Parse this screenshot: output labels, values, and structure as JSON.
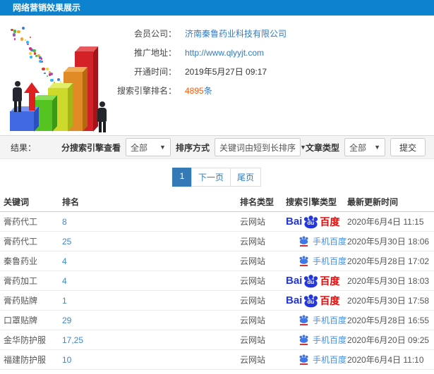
{
  "header": {
    "title": "网络营销效果展示"
  },
  "colors": {
    "header_bg": "#0d83cf",
    "link_blue": "#2f7bc3",
    "rank_link_blue": "#3a87d2",
    "highlight_red": "#ff5602",
    "pagination_active": "#337ab7",
    "baidu_blue": "#2336e0",
    "baidu_red": "#e10b0b",
    "mobile_baidu_blue": "#4a90e2"
  },
  "info": {
    "fields": [
      {
        "label": "会员公司：",
        "value": "济南秦鲁药业科技有限公司"
      },
      {
        "label": "推广地址：",
        "value": "http://www.qlyyjt.com"
      },
      {
        "label": "开通时间：",
        "value": "2019年5月27日 09:17"
      },
      {
        "label": "搜索引擎排名：",
        "value": "4895",
        "suffix": "条"
      }
    ]
  },
  "filters": {
    "result_label": "结果：",
    "engine_label": "分搜索引擎查看",
    "engine_value": "全部",
    "sort_label": "排序方式",
    "sort_value": "关键词由短到长排序",
    "article_label": "文章类型",
    "article_value": "全部",
    "submit_label": "提交",
    "caret": "▼"
  },
  "pagination": {
    "current": "1",
    "next": "下一页",
    "last": "尾页"
  },
  "table": {
    "columns": [
      "关键词",
      "排名",
      "排名类型",
      "搜索引擎类型",
      "最新更新时间"
    ],
    "engines": {
      "baidu_pc": {
        "bai": "Bai",
        "du": "du",
        "brand": "百度"
      },
      "baidu_mobile": {
        "label": "手机百度"
      }
    },
    "rows": [
      {
        "keyword": "膏药代工",
        "rank": "8",
        "rank_type": "云网站",
        "engine": "baidu-pc",
        "updated": "2020年6月4日 11:15"
      },
      {
        "keyword": "膏药代工",
        "rank": "25",
        "rank_type": "云网站",
        "engine": "baidu-mobile",
        "updated": "2020年5月30日 18:06"
      },
      {
        "keyword": "秦鲁药业",
        "rank": "4",
        "rank_type": "云网站",
        "engine": "baidu-mobile",
        "updated": "2020年5月28日 17:02"
      },
      {
        "keyword": "膏药加工",
        "rank": "4",
        "rank_type": "云网站",
        "engine": "baidu-pc",
        "updated": "2020年5月30日 18:03"
      },
      {
        "keyword": "膏药贴牌",
        "rank": "1",
        "rank_type": "云网站",
        "engine": "baidu-pc",
        "updated": "2020年5月30日 17:58"
      },
      {
        "keyword": "口罩贴牌",
        "rank": "29",
        "rank_type": "云网站",
        "engine": "baidu-mobile",
        "updated": "2020年5月28日 16:55"
      },
      {
        "keyword": "金华防护服",
        "rank": "17,25",
        "rank_type": "云网站",
        "engine": "baidu-mobile",
        "updated": "2020年6月20日 09:25"
      },
      {
        "keyword": "福建防护服",
        "rank": "10",
        "rank_type": "云网站",
        "engine": "baidu-mobile",
        "updated": "2020年6月4日 11:10"
      }
    ]
  }
}
